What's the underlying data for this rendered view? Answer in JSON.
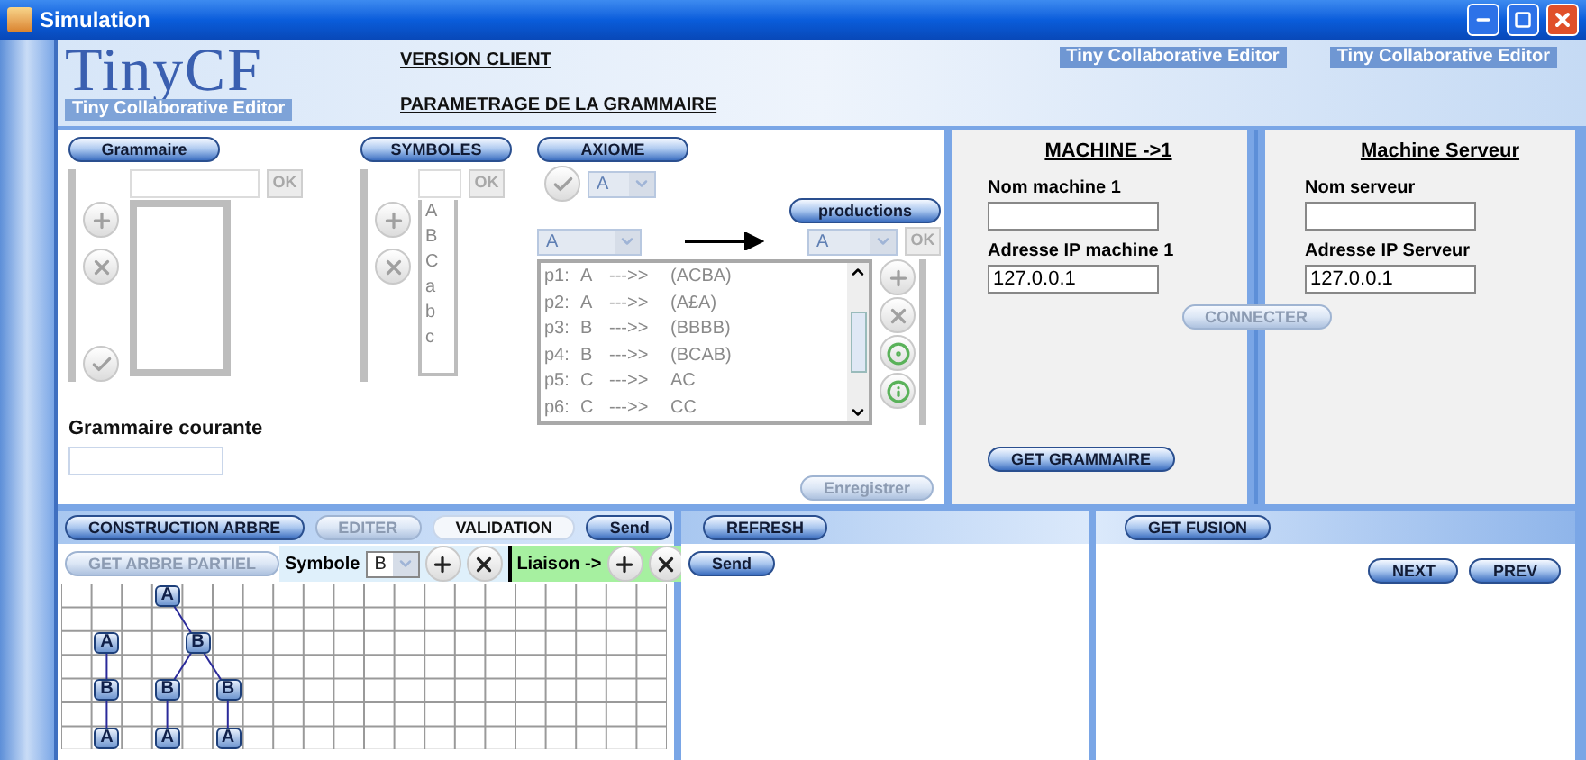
{
  "window": {
    "title": "Simulation"
  },
  "header": {
    "logo": "TinyCF",
    "tagline": "Tiny Collaborative Editor",
    "version": "VERSION CLIENT",
    "section": "PARAMETRAGE DE LA GRAMMAIRE",
    "banners": [
      "Tiny Collaborative Editor",
      "Tiny Collaborative Editor"
    ]
  },
  "grammaire": {
    "title": "Grammaire",
    "ok": {
      "label": "OK",
      "disabled": true
    },
    "current_label": "Grammaire courante"
  },
  "symboles": {
    "title": "SYMBOLES",
    "ok": {
      "label": "OK",
      "disabled": true
    },
    "items": [
      "A",
      "B",
      "C",
      "a",
      "b",
      "c"
    ]
  },
  "axiome": {
    "title": "AXIOME",
    "value": "A",
    "disabled": true
  },
  "productions": {
    "title": "productions",
    "left": "A",
    "right": "A",
    "ok": {
      "label": "OK",
      "disabled": true
    },
    "items": [
      {
        "id": "p1:",
        "lhs": "A",
        "arrow": "--->>",
        "rhs": "(ACBA)"
      },
      {
        "id": "p2:",
        "lhs": "A",
        "arrow": "--->>",
        "rhs": "(A£A)"
      },
      {
        "id": "p3:",
        "lhs": "B",
        "arrow": "--->>",
        "rhs": "(BBBB)"
      },
      {
        "id": "p4:",
        "lhs": "B",
        "arrow": "--->>",
        "rhs": "(BCAB)"
      },
      {
        "id": "p5:",
        "lhs": "C",
        "arrow": "--->>",
        "rhs": "AC"
      },
      {
        "id": "p6:",
        "lhs": "C",
        "arrow": "--->>",
        "rhs": "CC"
      }
    ]
  },
  "save_button": {
    "label": "Enregistrer",
    "disabled": true
  },
  "machine": {
    "title": "MACHINE ->1",
    "name_label": "Nom machine 1",
    "ip_label": "Adresse IP machine 1",
    "ip_value": "127.0.0.1",
    "button": {
      "label": "GET GRAMMAIRE",
      "disabled": false
    }
  },
  "connect_button": {
    "label": "CONNECTER",
    "disabled": true
  },
  "server": {
    "title": "Machine Serveur",
    "name_label": "Nom serveur",
    "ip_label": "Adresse IP Serveur",
    "ip_value": "127.0.0.1"
  },
  "tree_panel": {
    "tabs": [
      {
        "label": "CONSTRUCTION ARBRE",
        "selected": false,
        "disabled": false
      },
      {
        "label": "EDITER",
        "selected": false,
        "disabled": true
      },
      {
        "label": "VALIDATION",
        "selected": true,
        "disabled": false
      },
      {
        "label": "Send",
        "selected": false,
        "disabled": false
      }
    ],
    "partial_button": {
      "label": "GET ARBRE PARTIEL",
      "disabled": true
    },
    "symbol_label": "Symbole",
    "symbol_value": "B",
    "link_label": "Liaison ->",
    "trees": [
      {
        "label": "A",
        "children": [
          {
            "label": "B",
            "children": [
              {
                "label": "A"
              }
            ]
          }
        ]
      },
      {
        "label": "A",
        "children": [
          {
            "label": "B",
            "children": [
              {
                "label": "B",
                "children": [
                  {
                    "label": "A"
                  }
                ]
              },
              {
                "label": "B",
                "children": [
                  {
                    "label": "A"
                  }
                ]
              }
            ]
          }
        ]
      }
    ]
  },
  "refresh_panel": {
    "refresh": {
      "label": "REFRESH",
      "disabled": false
    },
    "send": {
      "label": "Send",
      "disabled": false
    }
  },
  "fusion_panel": {
    "get": {
      "label": "GET FUSION",
      "disabled": false
    },
    "next": {
      "label": "NEXT",
      "disabled": false
    },
    "prev": {
      "label": "PREV",
      "disabled": false
    }
  }
}
